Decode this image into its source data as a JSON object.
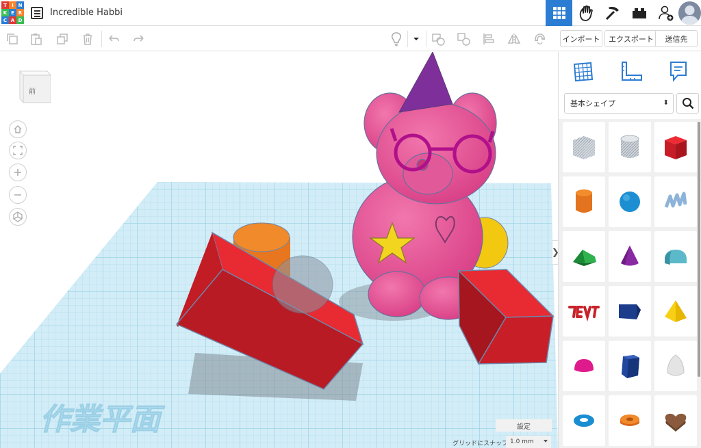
{
  "header": {
    "logo_letters": [
      "T",
      "I",
      "N",
      "K",
      "E",
      "R",
      "C",
      "A",
      "D"
    ],
    "logo_colors": [
      "#e03a36",
      "#f4842b",
      "#2b7fd6",
      "#3bbd55",
      "#2b7fd6",
      "#f4842b",
      "#2b7fd6",
      "#e03a36",
      "#3bbd55"
    ],
    "project_title": "Incredible Habbi",
    "nav_icons": [
      "grid-view-icon",
      "hand-wave-icon",
      "pickaxe-icon",
      "bricks-icon",
      "user-add-icon"
    ],
    "active_color": "#2b7cd3"
  },
  "toolbar": {
    "tools": [
      "copy-icon",
      "paste-icon",
      "duplicate-icon",
      "delete-icon",
      "undo-icon",
      "redo-icon",
      "lightbulb-icon",
      "group-icon",
      "ungroup-icon",
      "align-icon",
      "mirror-icon",
      "magnet-icon"
    ]
  },
  "actions": {
    "import_label": "インポート",
    "export_label": "エクスポート",
    "send_label": "送信先"
  },
  "viewport": {
    "viewcube_label": "前",
    "workplane_label": "作業平面",
    "nav": [
      "home-view-icon",
      "fit-view-icon",
      "zoom-in-icon",
      "zoom-out-icon",
      "perspective-icon"
    ],
    "settings_label": "設定",
    "snap_label": "グリッドにスナップ",
    "snap_value": "1.0 mm"
  },
  "panel": {
    "tabs": [
      "workplane-tab-icon",
      "ruler-tab-icon",
      "notes-tab-icon"
    ],
    "category": "基本シェイプ",
    "shapes": [
      "box-hole",
      "cylinder-hole",
      "box",
      "cylinder",
      "sphere",
      "scribble",
      "roof",
      "cone",
      "round-roof",
      "text",
      "polygon",
      "pyramid",
      "half-sphere",
      "hexagonal-prism",
      "paraboloid",
      "torus",
      "tube",
      "heart"
    ]
  }
}
